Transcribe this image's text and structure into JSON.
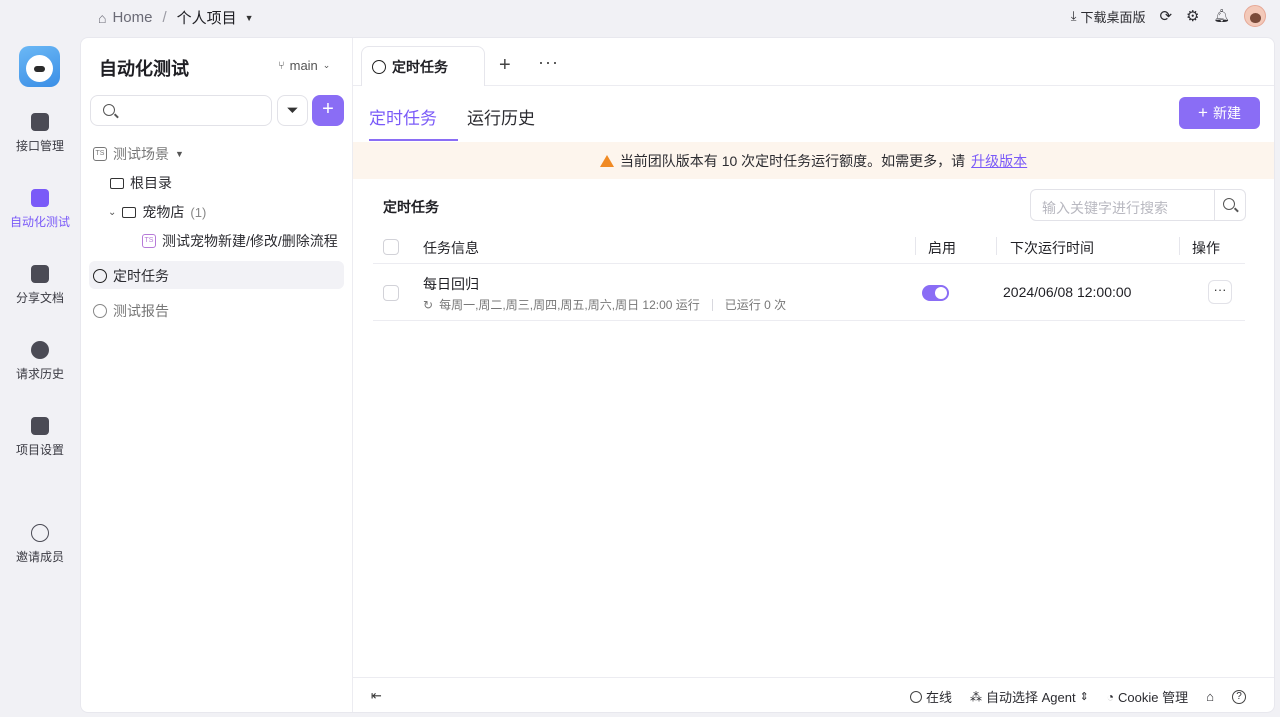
{
  "topbar": {
    "home_label": "Home",
    "separator": "/",
    "project_label": "个人项目",
    "download_label": "下载桌面版"
  },
  "leftnav": {
    "items": [
      {
        "label": "接口管理",
        "icon": "api-icon",
        "active": false
      },
      {
        "label": "自动化测试",
        "icon": "automation-icon",
        "active": true
      },
      {
        "label": "分享文档",
        "icon": "share-doc-icon",
        "active": false
      },
      {
        "label": "请求历史",
        "icon": "history-icon",
        "active": false
      },
      {
        "label": "项目设置",
        "icon": "settings-icon",
        "active": false
      },
      {
        "label": "邀请成员",
        "icon": "invite-icon",
        "active": false
      }
    ]
  },
  "sidebar": {
    "title": "自动化测试",
    "branch": "main",
    "search_placeholder": "",
    "tree": {
      "scenarios_label": "测试场景",
      "root_label": "根目录",
      "folder_label": "宠物店",
      "folder_count": "(1)",
      "case_label": "测试宠物新建/修改/删除流程",
      "ts_badge": "TS"
    },
    "scheduled_label": "定时任务",
    "reports_label": "测试报告"
  },
  "main": {
    "tab_label": "定时任务",
    "subtabs": [
      "定时任务",
      "运行历史"
    ],
    "new_button": "新建",
    "banner_text": "当前团队版本有 10 次定时任务运行额度。如需更多，请",
    "banner_link": "升级版本",
    "section_title": "定时任务",
    "search_placeholder": "输入关键字进行搜索",
    "columns": {
      "info": "任务信息",
      "enabled": "启用",
      "next_run": "下次运行时间",
      "actions": "操作"
    },
    "rows": [
      {
        "name": "每日回归",
        "schedule": "每周一,周二,周三,周四,周五,周六,周日 12:00 运行",
        "run_count": "已运行 0 次",
        "enabled": true,
        "next_run": "2024/06/08 12:00:00",
        "more": "···"
      }
    ]
  },
  "footer": {
    "online": "在线",
    "agent": "自动选择 Agent",
    "cookie": "Cookie 管理"
  },
  "colors": {
    "accent": "#7a5af8",
    "warning": "#f08a24",
    "banner_bg": "#fdf5ed"
  }
}
